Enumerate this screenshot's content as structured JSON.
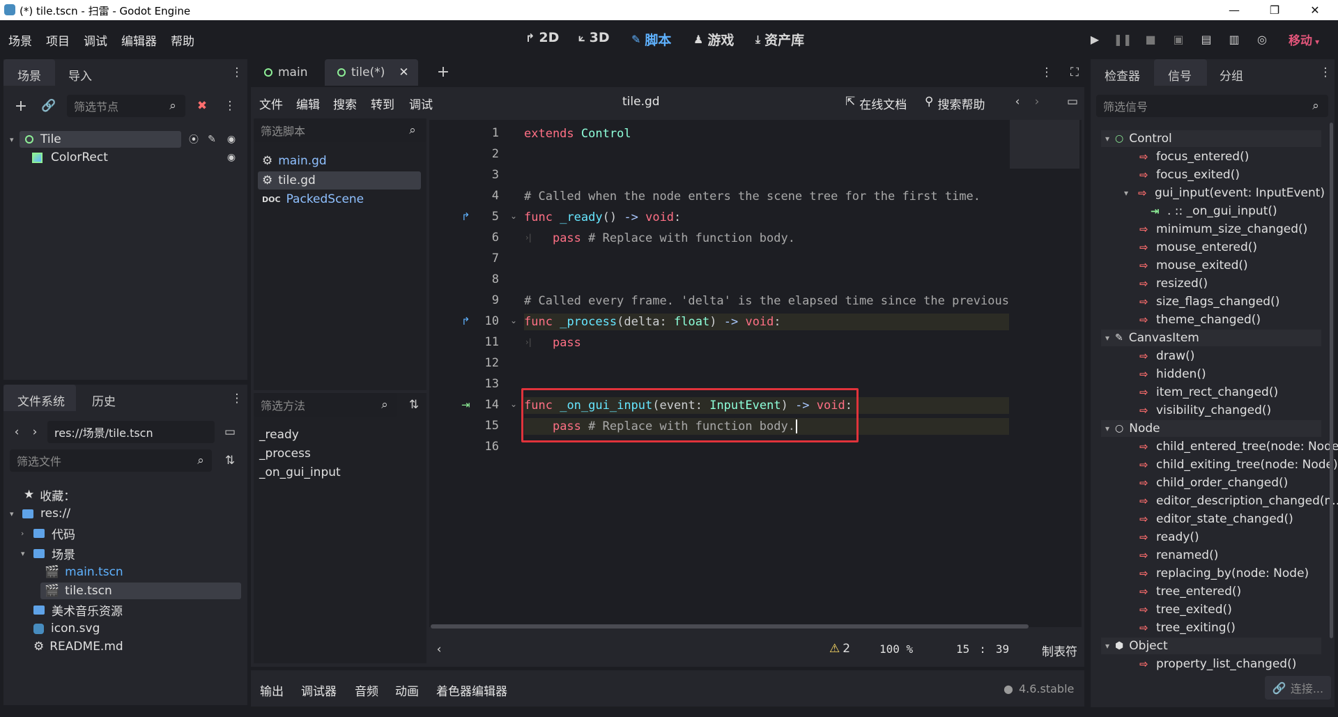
{
  "window": {
    "title": "(*) tile.tscn - 扫雷 - Godot Engine",
    "minimize": "—",
    "maximize": "❐",
    "close": "✕"
  },
  "menu": [
    "场景",
    "项目",
    "调试",
    "编辑器",
    "帮助"
  ],
  "workspaces": [
    {
      "label": "2D",
      "icon": "2d-icon"
    },
    {
      "label": "3D",
      "icon": "3d-icon"
    },
    {
      "label": "脚本",
      "icon": "script-icon",
      "active": true
    },
    {
      "label": "游戏",
      "icon": "game-icon"
    },
    {
      "label": "资产库",
      "icon": "assetlib-icon"
    }
  ],
  "renderer": "移动",
  "scene_dock": {
    "tabs": [
      "场景",
      "导入"
    ],
    "filter_placeholder": "筛选节点",
    "nodes": [
      {
        "name": "Tile",
        "type": "Control",
        "selected": true
      },
      {
        "name": "ColorRect",
        "type": "ColorRect"
      }
    ]
  },
  "filesystem_dock": {
    "tabs": [
      "文件系统",
      "历史"
    ],
    "path": "res://场景/tile.tscn",
    "filter_placeholder": "筛选文件",
    "items": [
      {
        "label": "收藏：",
        "kind": "favorites"
      },
      {
        "label": "res://",
        "kind": "folder"
      },
      {
        "label": "代码",
        "kind": "folder"
      },
      {
        "label": "场景",
        "kind": "folder"
      },
      {
        "label": "main.tscn",
        "kind": "scene"
      },
      {
        "label": "tile.tscn",
        "kind": "scene",
        "selected": true
      },
      {
        "label": "美术音乐资源",
        "kind": "folder"
      },
      {
        "label": "icon.svg",
        "kind": "image"
      },
      {
        "label": "README.md",
        "kind": "file"
      }
    ]
  },
  "scene_tabs": [
    "main",
    "tile(*)"
  ],
  "script_menu": [
    "文件",
    "编辑",
    "搜索",
    "转到",
    "调试"
  ],
  "script_filename": "tile.gd",
  "online_docs": "在线文档",
  "search_help": "搜索帮助",
  "script_filter_placeholder": "筛选脚本",
  "scripts": [
    "main.gd",
    "tile.gd",
    "PackedScene"
  ],
  "method_filter_placeholder": "筛选方法",
  "methods": [
    "_ready",
    "_process",
    "_on_gui_input"
  ],
  "code": {
    "lines": [
      {
        "n": "1",
        "text": "extends Control"
      },
      {
        "n": "2",
        "text": ""
      },
      {
        "n": "3",
        "text": ""
      },
      {
        "n": "4",
        "text": "# Called when the node enters the scene tree for the first time."
      },
      {
        "n": "5",
        "text": "func _ready() -> void:"
      },
      {
        "n": "6",
        "text": "pass # Replace with function body."
      },
      {
        "n": "7",
        "text": ""
      },
      {
        "n": "8",
        "text": ""
      },
      {
        "n": "9",
        "text": "# Called every frame. 'delta' is the elapsed time since the previous"
      },
      {
        "n": "10",
        "text": "func _process(delta: float) -> void:"
      },
      {
        "n": "11",
        "text": "pass"
      },
      {
        "n": "12",
        "text": ""
      },
      {
        "n": "13",
        "text": ""
      },
      {
        "n": "14",
        "text": "func _on_gui_input(event: InputEvent) -> void:"
      },
      {
        "n": "15",
        "text": "pass # Replace with function body."
      },
      {
        "n": "16",
        "text": ""
      }
    ],
    "tokens": {
      "extends": "extends",
      "Control": "Control",
      "func": "func",
      "arrow": "->",
      "void": "void",
      "colon": ":",
      "pass": "pass",
      "ready": "_ready",
      "process": "_process",
      "on_gui_input": "_on_gui_input",
      "parens_empty": "()",
      "lparen": "(",
      "rparen": ")",
      "delta": "delta",
      "float": "float",
      "event": "event",
      "InputEvent": "InputEvent",
      "comment_replace": "# Replace with function body.",
      "comment_ready": "# Called when the node enters the scene tree for the first time.",
      "comment_process": "# Called every frame. 'delta' is the elapsed time since the previous"
    }
  },
  "status": {
    "warnings": "2",
    "zoom": "100 %",
    "line": "15",
    "sep": ":",
    "col": "39",
    "indent": "制表符"
  },
  "bottom_tabs": [
    "输出",
    "调试器",
    "音频",
    "动画",
    "着色器编辑器"
  ],
  "version": "4.6.stable",
  "right_dock": {
    "tabs": [
      "检查器",
      "信号",
      "分组"
    ],
    "filter_placeholder": "筛选信号",
    "connect_button": "连接..."
  },
  "signals": [
    {
      "kind": "class",
      "label": "Control",
      "icon": "control-icon"
    },
    {
      "kind": "signal",
      "label": "focus_entered()"
    },
    {
      "kind": "signal",
      "label": "focus_exited()"
    },
    {
      "kind": "signal-expanded",
      "label": "gui_input(event: InputEvent)"
    },
    {
      "kind": "connection",
      "label": ". :: _on_gui_input()"
    },
    {
      "kind": "signal",
      "label": "minimum_size_changed()"
    },
    {
      "kind": "signal",
      "label": "mouse_entered()"
    },
    {
      "kind": "signal",
      "label": "mouse_exited()"
    },
    {
      "kind": "signal",
      "label": "resized()"
    },
    {
      "kind": "signal",
      "label": "size_flags_changed()"
    },
    {
      "kind": "signal",
      "label": "theme_changed()"
    },
    {
      "kind": "class",
      "label": "CanvasItem",
      "icon": "canvasitem-icon"
    },
    {
      "kind": "signal",
      "label": "draw()"
    },
    {
      "kind": "signal",
      "label": "hidden()"
    },
    {
      "kind": "signal",
      "label": "item_rect_changed()"
    },
    {
      "kind": "signal",
      "label": "visibility_changed()"
    },
    {
      "kind": "class",
      "label": "Node",
      "icon": "node-icon"
    },
    {
      "kind": "signal",
      "label": "child_entered_tree(node: Node)"
    },
    {
      "kind": "signal",
      "label": "child_exiting_tree(node: Node)"
    },
    {
      "kind": "signal",
      "label": "child_order_changed()"
    },
    {
      "kind": "signal",
      "label": "editor_description_changed(n..."
    },
    {
      "kind": "signal",
      "label": "editor_state_changed()"
    },
    {
      "kind": "signal",
      "label": "ready()"
    },
    {
      "kind": "signal",
      "label": "renamed()"
    },
    {
      "kind": "signal",
      "label": "replacing_by(node: Node)"
    },
    {
      "kind": "signal",
      "label": "tree_entered()"
    },
    {
      "kind": "signal",
      "label": "tree_exited()"
    },
    {
      "kind": "signal",
      "label": "tree_exiting()"
    },
    {
      "kind": "class",
      "label": "Object",
      "icon": "object-icon"
    },
    {
      "kind": "signal",
      "label": "property_list_changed()"
    }
  ]
}
